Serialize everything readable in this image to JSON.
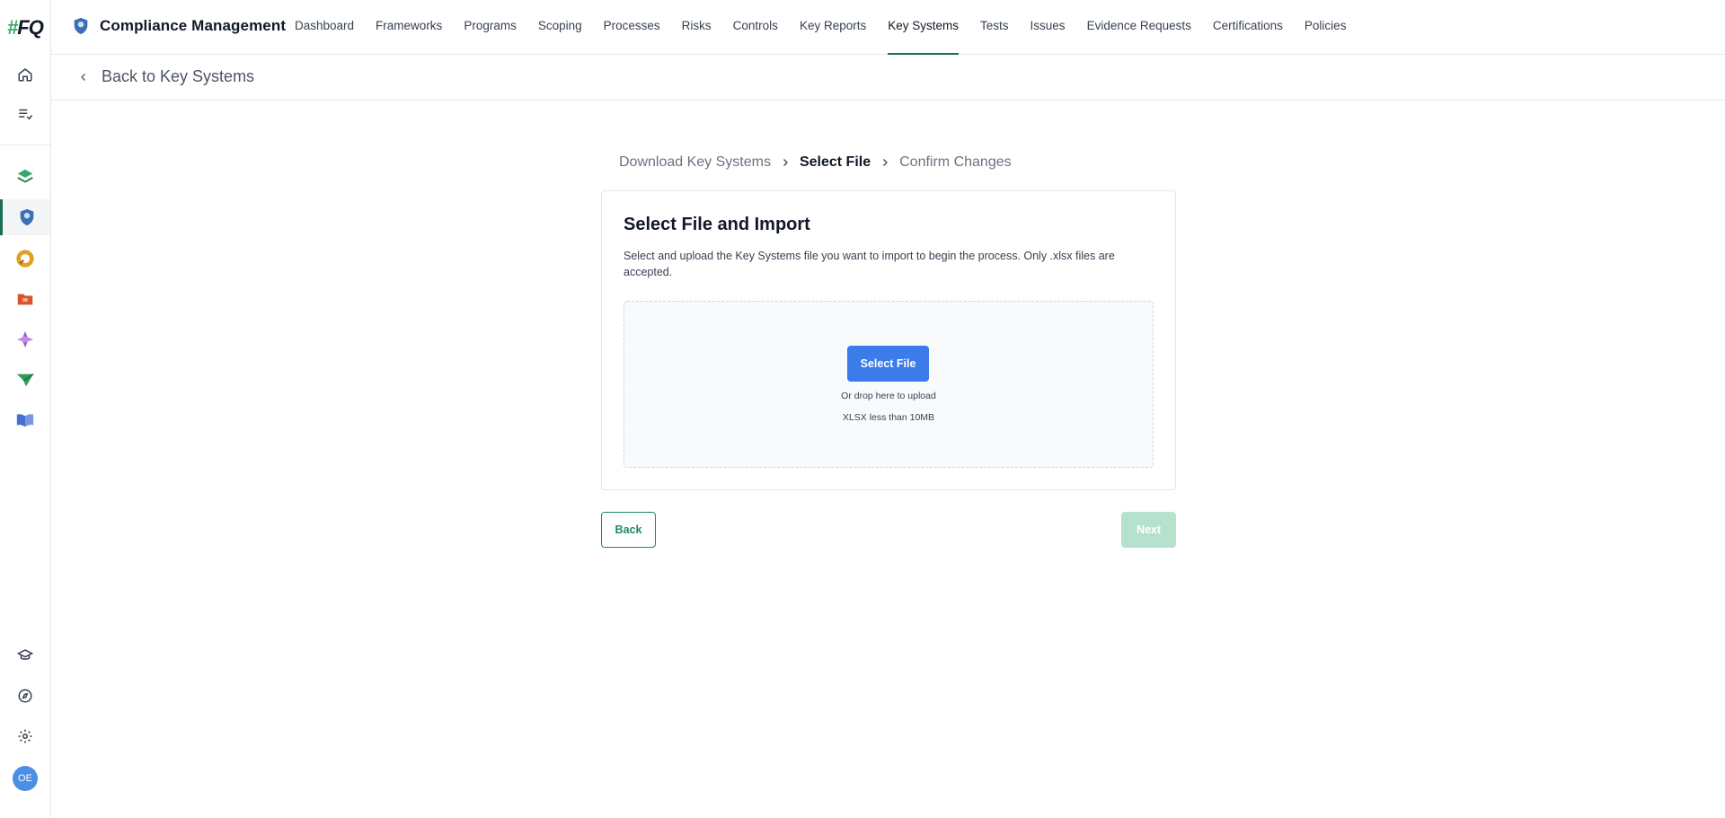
{
  "sidebar": {
    "logo": {
      "hash": "#",
      "text": "FQ"
    },
    "icons": [
      {
        "name": "home-icon"
      },
      {
        "name": "task-list-icon"
      },
      {
        "name": "layers-module-icon",
        "color": "#3aa56b"
      },
      {
        "name": "compliance-shield-icon",
        "color": "#3b6fb6",
        "active": true
      },
      {
        "name": "ring-module-icon",
        "color": "#e0a020"
      },
      {
        "name": "folder-module-icon",
        "color": "#d9532c"
      },
      {
        "name": "diamond-module-icon",
        "color": "#9b59d0"
      },
      {
        "name": "paper-plane-module-icon",
        "color": "#2e9e5b"
      },
      {
        "name": "book-module-icon",
        "color": "#4a6fd0"
      }
    ],
    "bottom_icons": [
      {
        "name": "academy-icon"
      },
      {
        "name": "compass-icon"
      },
      {
        "name": "settings-icon"
      }
    ],
    "avatar_initials": "OE",
    "avatar_color": "#4a8ee6"
  },
  "header": {
    "app_title": "Compliance Management",
    "tabs": [
      {
        "label": "Dashboard"
      },
      {
        "label": "Frameworks"
      },
      {
        "label": "Programs"
      },
      {
        "label": "Scoping"
      },
      {
        "label": "Processes"
      },
      {
        "label": "Risks"
      },
      {
        "label": "Controls"
      },
      {
        "label": "Key Reports"
      },
      {
        "label": "Key Systems",
        "active": true
      },
      {
        "label": "Tests"
      },
      {
        "label": "Issues"
      },
      {
        "label": "Evidence Requests"
      },
      {
        "label": "Certifications"
      },
      {
        "label": "Policies"
      }
    ],
    "active_color": "#1d6d55"
  },
  "subheader": {
    "back_label": "Back to Key Systems"
  },
  "stepper": {
    "steps": [
      {
        "label": "Download Key Systems"
      },
      {
        "label": "Select File",
        "current": true
      },
      {
        "label": "Confirm Changes"
      }
    ]
  },
  "card": {
    "title": "Select File and Import",
    "description": "Select and upload the Key Systems file you want to import to begin the process. Only .xlsx files are accepted.",
    "dropzone": {
      "button_label": "Select File",
      "hint": "Or drop here to upload",
      "limit": "XLSX less than 10MB"
    }
  },
  "footer": {
    "back_label": "Back",
    "next_label": "Next"
  },
  "colors": {
    "primary_blue": "#3b7bea",
    "brand_green": "#1d8a5e",
    "disabled_green": "#b6e2cd"
  }
}
